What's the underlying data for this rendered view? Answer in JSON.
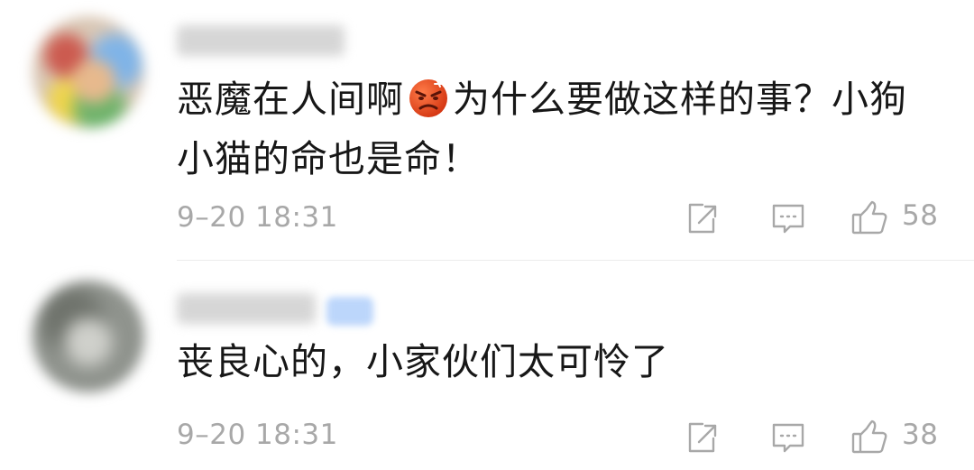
{
  "comments": [
    {
      "text_before_emoji": "恶魔在人间啊",
      "emoji": "angry-face-emoji",
      "text_after_emoji": "为什么要做这样的事？小狗",
      "text_line2": "小猫的命也是命！",
      "timestamp": "9–20 18:31",
      "likes": "58",
      "actions": [
        "share-icon",
        "comment-icon",
        "like-icon"
      ]
    },
    {
      "text": "丧良心的，小家伙们太可怜了",
      "timestamp": "9–20 18:31",
      "likes": "38",
      "actions": [
        "share-icon",
        "comment-icon",
        "like-icon"
      ]
    }
  ],
  "colors": {
    "text": "#171717",
    "meta": "#a8a8a8",
    "divider": "#ececec",
    "badge": "#bcd6fb"
  }
}
